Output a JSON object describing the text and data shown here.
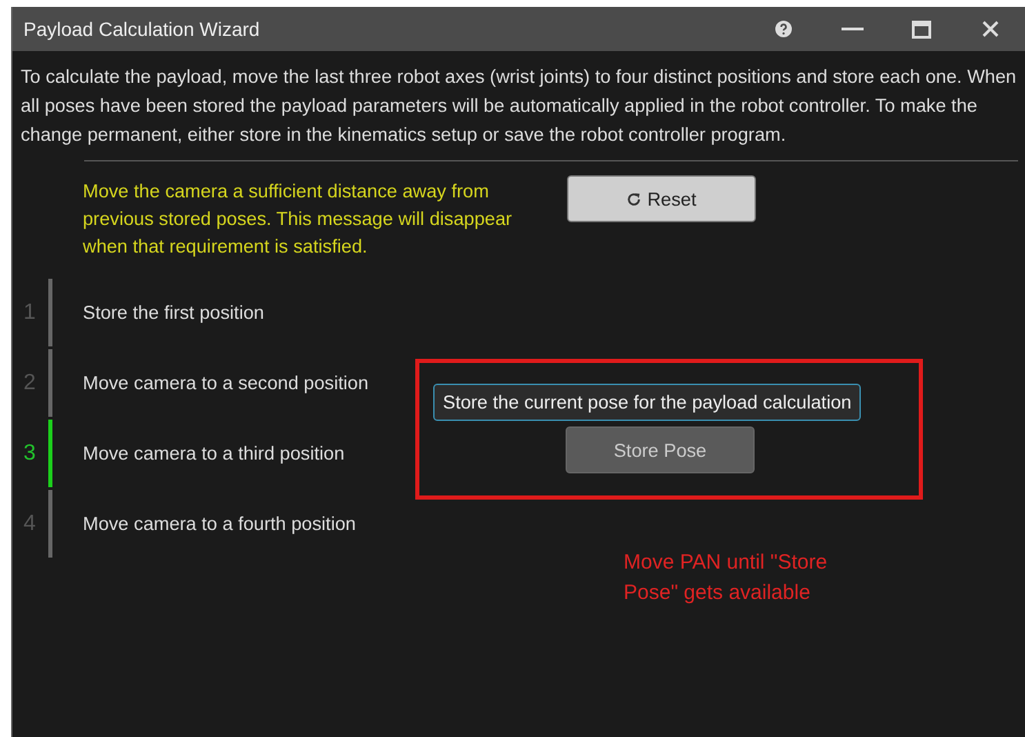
{
  "window": {
    "title": "Payload Calculation Wizard"
  },
  "description": "To calculate the payload, move the last three robot axes (wrist joints) to four distinct positions and store each one. When all poses have been stored the payload parameters will be automatically applied in the robot controller. To make the change permanent, either store in the kinematics setup or save the robot controller program.",
  "warning": "Move the camera a sufficient distance away from previous stored poses. This message will disappear when that requirement is satisfied.",
  "reset_button": {
    "label": "Reset"
  },
  "steps": [
    {
      "number": "1",
      "label": "Store the first position",
      "selected": false
    },
    {
      "number": "2",
      "label": "Move camera to a second position",
      "selected": false
    },
    {
      "number": "3",
      "label": "Move camera to a third position",
      "selected": true
    },
    {
      "number": "4",
      "label": "Move camera to a fourth position",
      "selected": false
    }
  ],
  "tooltip": "Store the current pose for the payload calculation",
  "store_button": {
    "label": "Store Pose",
    "disabled": true
  },
  "annotation": "Move PAN until \"Store Pose\" gets available"
}
